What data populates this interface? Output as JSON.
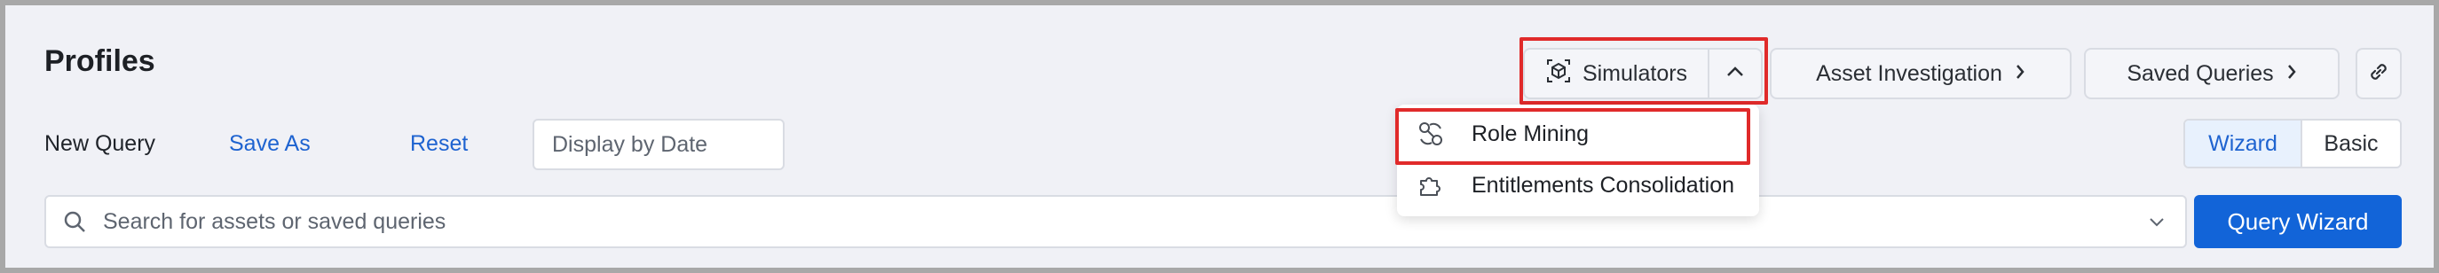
{
  "page": {
    "title": "Profiles"
  },
  "toolbar": {
    "simulators_label": "Simulators",
    "asset_investigation_label": "Asset Investigation",
    "saved_queries_label": "Saved Queries"
  },
  "query_bar": {
    "new_query_label": "New Query",
    "save_as_label": "Save As",
    "reset_label": "Reset",
    "display_by_date_placeholder": "Display by Date"
  },
  "mode_toggle": {
    "options": [
      "Wizard",
      "Basic"
    ],
    "selected": "Wizard"
  },
  "simulators_menu": {
    "items": [
      {
        "label": "Role Mining",
        "icon": "role-mining-icon"
      },
      {
        "label": "Entitlements Consolidation",
        "icon": "puzzle-icon"
      }
    ]
  },
  "search": {
    "placeholder": "Search for assets or saved queries"
  },
  "actions": {
    "query_wizard_label": "Query Wizard"
  },
  "colors": {
    "accent": "#1264d8",
    "highlight": "#e02a2a",
    "background": "#f0f1f6"
  }
}
